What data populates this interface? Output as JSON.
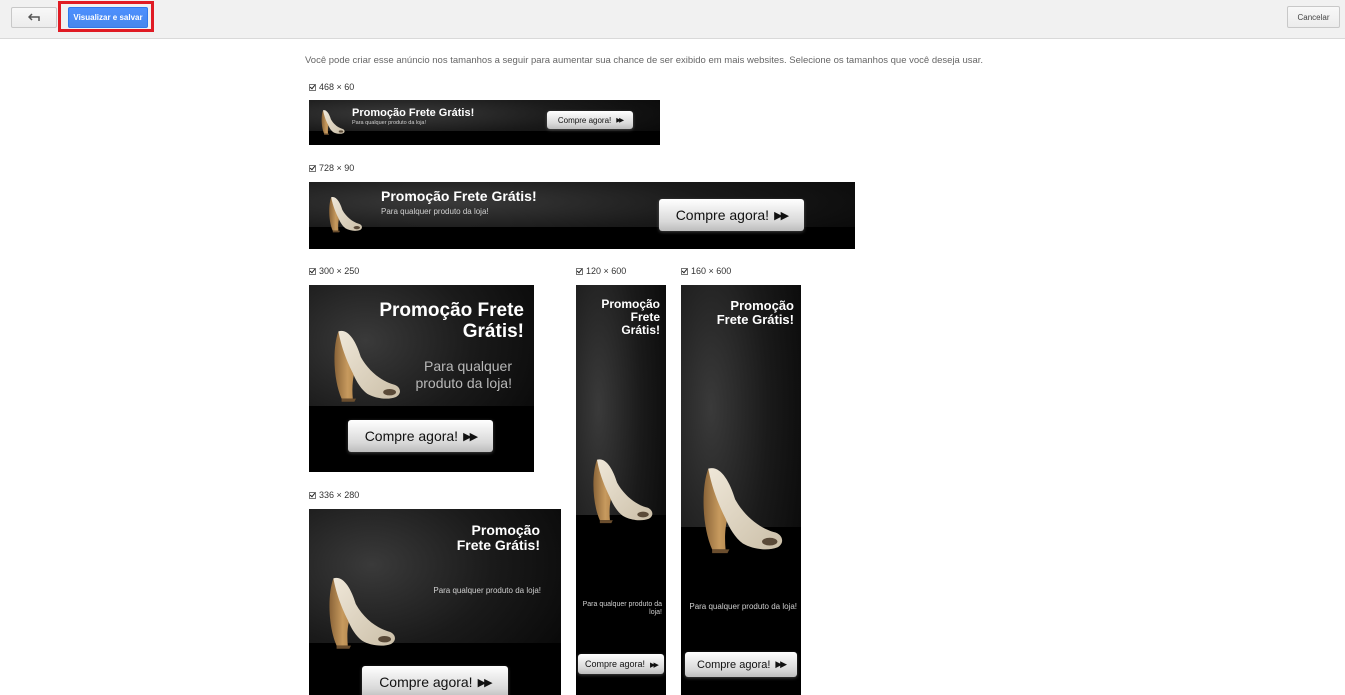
{
  "toolbar": {
    "back_icon": "undo-arrow-icon",
    "save_label": "Visualizar e salvar",
    "cancel_label": "Cancelar",
    "highlight_color": "#e01b24"
  },
  "intro": "Você pode criar esse anúncio nos tamanhos a seguir para aumentar sua chance de ser exibido em mais websites. Selecione os tamanhos que você deseja usar.",
  "ad_copy": {
    "title": "Promoção Frete Grátis!",
    "title_line1": "Promoção Frete",
    "title_line2": "Grátis!",
    "title_short1": "Promoção",
    "title_short2": "Frete Grátis!",
    "title_tall1": "Promoção",
    "title_tall2": "Frete",
    "title_tall3": "Grátis!",
    "subtitle": "Para qualquer produto da loja!",
    "subtitle_line1": "Para qualquer",
    "subtitle_line2": "produto da loja!",
    "cta": "Compre agora!"
  },
  "sizes": [
    {
      "label": "468 × 60",
      "checked": true
    },
    {
      "label": "728 × 90",
      "checked": true
    },
    {
      "label": "300 × 250",
      "checked": true
    },
    {
      "label": "120 × 600",
      "checked": true
    },
    {
      "label": "160 × 600",
      "checked": true
    },
    {
      "label": "336 × 280",
      "checked": true
    }
  ]
}
